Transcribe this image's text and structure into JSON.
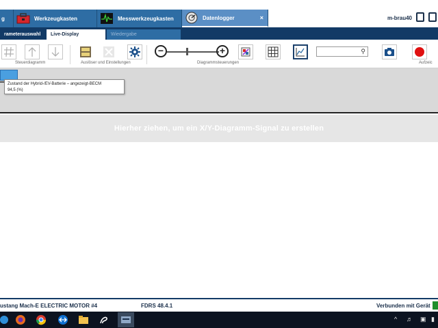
{
  "top_tabs": [
    {
      "label": "g"
    },
    {
      "label": "Werkzeugkasten"
    },
    {
      "label": "Messwerkzeugkasten"
    },
    {
      "label": "Datenlogger",
      "close": "×"
    }
  ],
  "user": "m-brau40",
  "sub_tabs": [
    {
      "label": "rameterauswahl"
    },
    {
      "label": "Live-Display"
    },
    {
      "label": "Wiedergabe"
    }
  ],
  "toolbar": {
    "groups": {
      "steuerdiagramm": "Steuerdiagramm",
      "auswahl": "Auslöser und Einstellungen",
      "diagramm": "Diagrammsteuerungen",
      "aufzeichnen": "Aufzeic"
    },
    "search_placeholder": "",
    "icons": [
      "hash-icon",
      "arrow-up-icon",
      "arrow-down-icon",
      "trigger-icon",
      "cross-icon",
      "gear-icon",
      "zoom-out-icon",
      "zoom-in-icon",
      "palette-icon",
      "grid-icon",
      "graph-icon",
      "search-icon",
      "camera-icon",
      "record-icon"
    ]
  },
  "tooltip": {
    "title": "Zustand der Hybrid-/EV-Batterie – angezeigt-BECM",
    "value": "94,5 (%)"
  },
  "drop_hint": "Hierher ziehen, um ein X/Y-Diagramm-Signal zu erstellen",
  "status": {
    "vehicle": "ustang Mach-E ELECTRIC MOTOR #4",
    "version": "FDRS 48.4.1",
    "connection": "Verbunden mit Gerät"
  },
  "colors": {
    "brand_dark": "#123a66",
    "tab_blue": "#2e6da4",
    "status_ok": "#1f8f2a"
  }
}
